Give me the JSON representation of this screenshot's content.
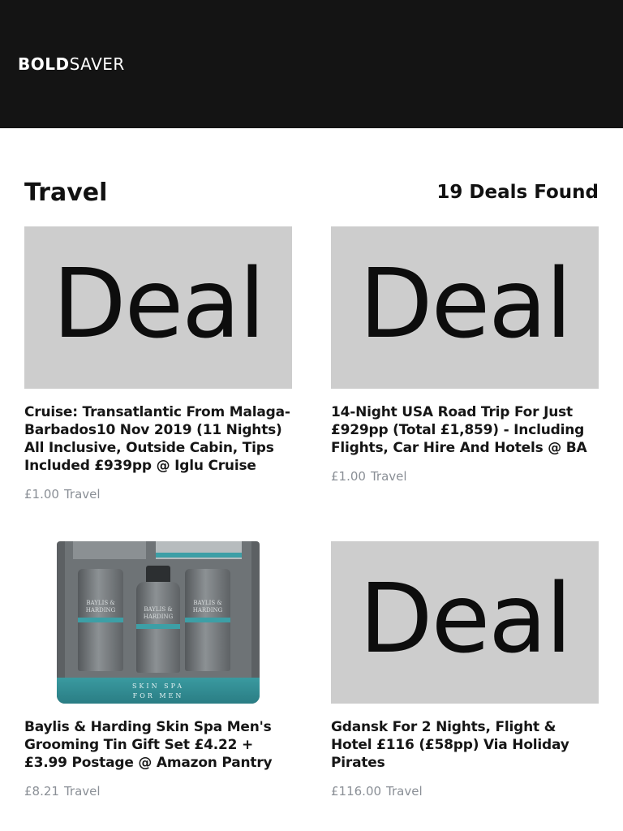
{
  "header": {
    "logo_bold": "BOLD",
    "logo_light": "SAVER"
  },
  "page": {
    "title": "Travel",
    "deals_found": "19 Deals Found"
  },
  "deals": [
    {
      "image_placeholder": "Deal",
      "title": "Cruise: Transatlantic From Malaga-Barbados10 Nov 2019 (11 Nights) All Inclusive, Outside Cabin, Tips Included £939pp @ Iglu Cruise",
      "price": "£1.00",
      "category": "Travel"
    },
    {
      "image_placeholder": "Deal",
      "title": "14-Night USA Road Trip For Just £929pp (Total £1,859) - Including Flights, Car Hire And Hotels @ BA",
      "price": "£1.00",
      "category": "Travel"
    },
    {
      "image_tin_labels": {
        "brand_line1": "BAYLIS &",
        "brand_line2": "HARDING",
        "lid_line1": "SKIN SPA",
        "lid_line2": "FOR MEN"
      },
      "title": "Baylis & Harding Skin Spa Men's Grooming Tin Gift Set £4.22 + £3.99 Postage @ Amazon Pantry",
      "price": "£8.21",
      "category": "Travel"
    },
    {
      "image_placeholder": "Deal",
      "title": "Gdansk For 2 Nights, Flight & Hotel £116 (£58pp) Via Holiday Pirates",
      "price": "£116.00",
      "category": "Travel"
    }
  ],
  "colors": {
    "header_bg": "#141414",
    "placeholder_bg": "#cdcdcd",
    "meta_text": "#8a8f96",
    "accent_teal": "#3d9fa6"
  }
}
